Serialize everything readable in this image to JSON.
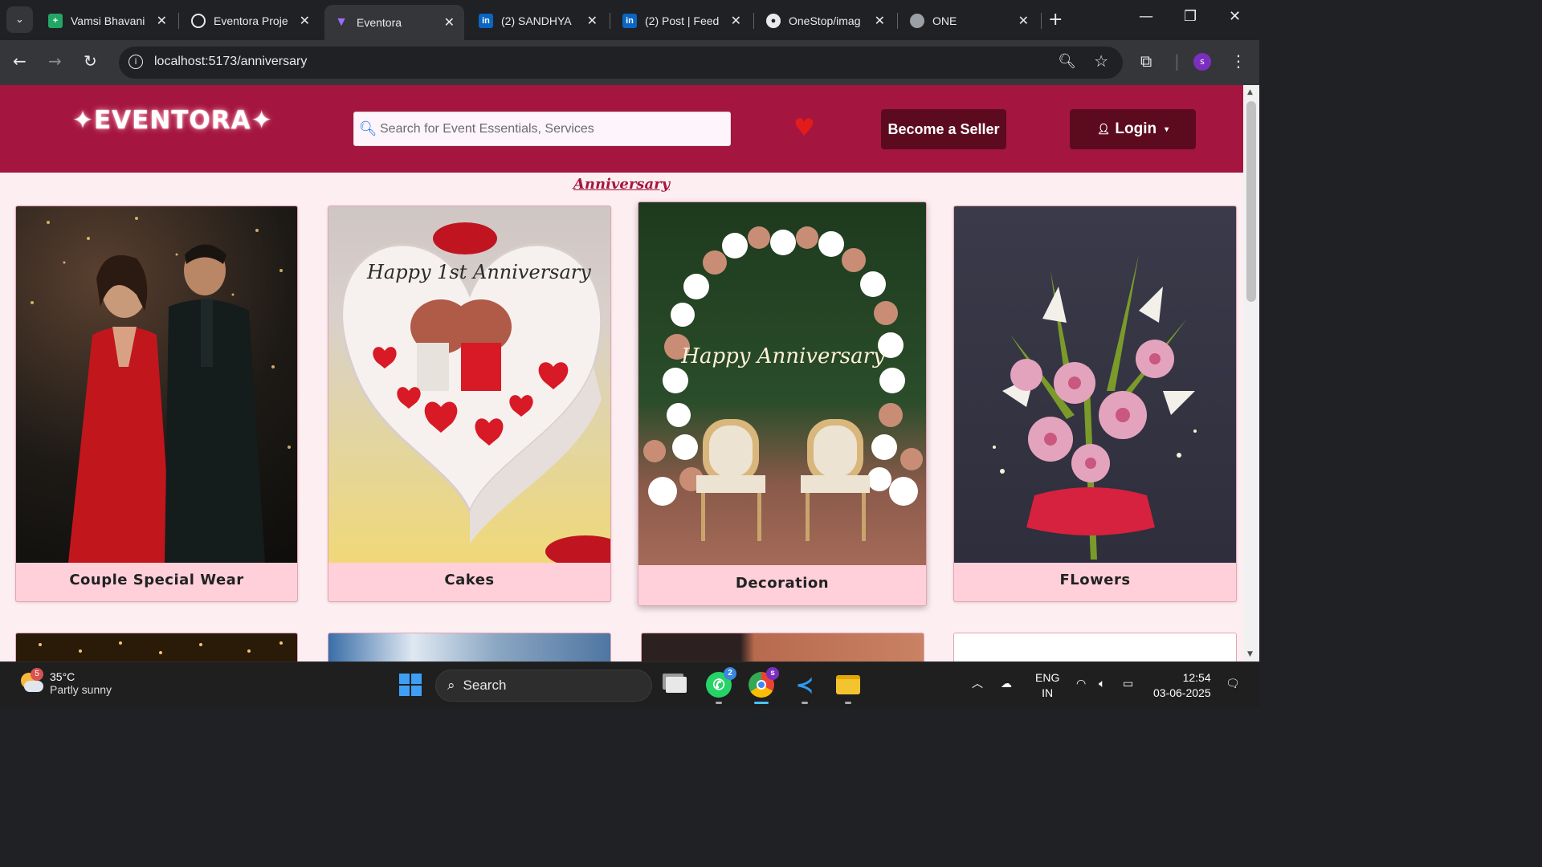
{
  "browser": {
    "tabs": [
      {
        "title": "Vamsi Bhavani",
        "favicon": "sheets-icon",
        "color": "#23a566"
      },
      {
        "title": "Eventora Proje",
        "favicon": "chatgpt-icon",
        "color": "#ffffff"
      },
      {
        "title": "Eventora",
        "favicon": "vite-icon",
        "color": "#9d6bff",
        "active": true
      },
      {
        "title": "(2) SANDHYA",
        "favicon": "linkedin-icon",
        "color": "#0a66c2"
      },
      {
        "title": "(2) Post | Feed",
        "favicon": "linkedin-icon",
        "color": "#0a66c2"
      },
      {
        "title": "OneStop/imag",
        "favicon": "github-icon",
        "color": "#ffffff"
      },
      {
        "title": "ONE",
        "favicon": "globe-icon",
        "color": "#9aa0a6"
      }
    ],
    "url": "localhost:5173/anniversary",
    "profile_initial": "s"
  },
  "site": {
    "logo": "✦EVENTORA✦",
    "search_placeholder": "Search for Event Essentials, Services",
    "seller_label": "Become a Seller",
    "login_label": "Login",
    "section_title": "Anniversary",
    "brand_color": "#a4163f",
    "button_color": "#5c0b1f",
    "categories": [
      {
        "label": "Couple Special Wear",
        "image": "couple-photo"
      },
      {
        "label": "Cakes",
        "image": "cake-photo",
        "cake_text": "Happy 1st Anniversary"
      },
      {
        "label": "Decoration",
        "image": "decoration-photo",
        "neon_text": "Happy Anniversary"
      },
      {
        "label": "FLowers",
        "image": "flowers-photo"
      }
    ]
  },
  "taskbar": {
    "weather_badge": "5",
    "temperature": "35°C",
    "condition": "Partly sunny",
    "search_label": "Search",
    "whatsapp_badge": "2",
    "chrome_badge": "s",
    "language": "ENG",
    "region": "IN",
    "time": "12:54",
    "date": "03-06-2025"
  }
}
